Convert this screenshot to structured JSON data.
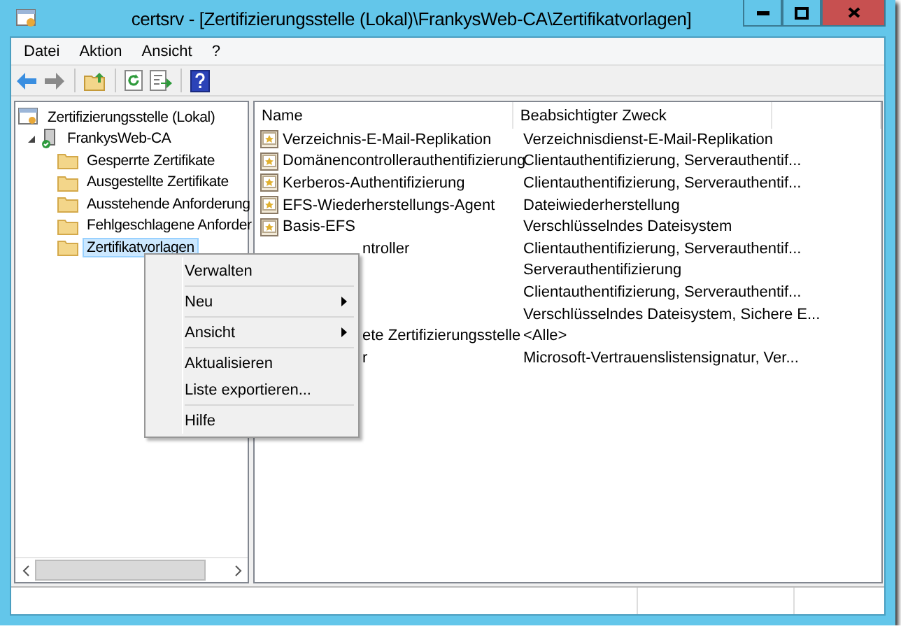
{
  "window": {
    "title": "certsrv - [Zertifizierungsstelle (Lokal)\\FrankysWeb-CA\\Zertifikatvorlagen]"
  },
  "menu_bar": [
    "Datei",
    "Aktion",
    "Ansicht",
    "?"
  ],
  "tree": {
    "root": {
      "label": "Zertifizierungsstelle (Lokal)",
      "children": [
        {
          "label": "FrankysWeb-CA",
          "expanded": true,
          "children": [
            {
              "label": "Gesperrte Zertifikate",
              "selected": false
            },
            {
              "label": "Ausgestellte Zertifikate",
              "selected": false
            },
            {
              "label": "Ausstehende Anforderung",
              "selected": false
            },
            {
              "label": "Fehlgeschlagene Anforder",
              "selected": false
            },
            {
              "label": "Zertifikatvorlagen",
              "selected": true
            }
          ]
        }
      ]
    }
  },
  "list": {
    "columns": [
      "Name",
      "Beabsichtigter Zweck"
    ],
    "rows": [
      {
        "name": "Verzeichnis-E-Mail-Replikation",
        "purpose": "Verzeichnisdienst-E-Mail-Replikation",
        "covered": false
      },
      {
        "name": "Domänencontrollerauthentifizierung",
        "purpose": "Clientauthentifizierung, Serverauthentif...",
        "covered": false
      },
      {
        "name": "Kerberos-Authentifizierung",
        "purpose": "Clientauthentifizierung, Serverauthentif...",
        "covered": false
      },
      {
        "name": "EFS-Wiederherstellungs-Agent",
        "purpose": "Dateiwiederherstellung",
        "covered": false
      },
      {
        "name": "Basis-EFS",
        "purpose": "Verschlüsselndes Dateisystem",
        "covered": false
      },
      {
        "name": "ntroller",
        "purpose": "Clientauthentifizierung, Serverauthentif...",
        "covered": true
      },
      {
        "purpose": "Serverauthentifizierung"
      },
      {
        "purpose": "Clientauthentifizierung, Serverauthentif..."
      },
      {
        "purpose": "Verschlüsselndes Dateisystem, Sichere E..."
      },
      {
        "name": "ete Zertifizierungsstelle",
        "purpose": "<Alle>",
        "covered": true
      },
      {
        "name": "r",
        "purpose": "Microsoft-Vertrauenslistensignatur, Ver...",
        "covered": true
      }
    ]
  },
  "context_menu": {
    "items": [
      {
        "kind": "item",
        "label": "Verwalten",
        "submenu": false
      },
      {
        "kind": "separator"
      },
      {
        "kind": "item",
        "label": "Neu",
        "submenu": true
      },
      {
        "kind": "separator"
      },
      {
        "kind": "item",
        "label": "Ansicht",
        "submenu": true
      },
      {
        "kind": "separator"
      },
      {
        "kind": "item",
        "label": "Aktualisieren",
        "submenu": false
      },
      {
        "kind": "item",
        "label": "Liste exportieren...",
        "submenu": false
      },
      {
        "kind": "separator"
      },
      {
        "kind": "item",
        "label": "Hilfe",
        "submenu": false
      }
    ]
  }
}
